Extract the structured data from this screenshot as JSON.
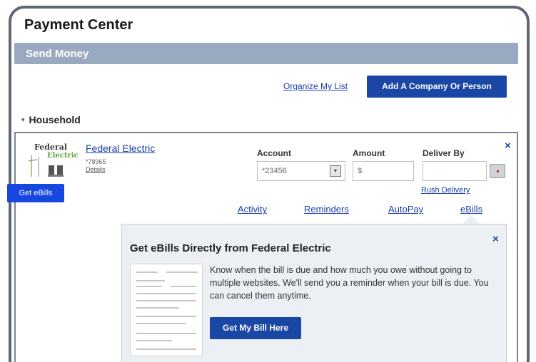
{
  "page": {
    "title": "Payment Center"
  },
  "section": {
    "title": "Send Money"
  },
  "toolbar": {
    "organize_label": "Organize My List",
    "add_label": "Add A Company Or Person"
  },
  "group": {
    "name": "Household"
  },
  "payee": {
    "logo_line1": "Federal",
    "logo_line2": "Electric",
    "name": "Federal Electric",
    "account_masked": "*78965",
    "details_label": "Details",
    "get_ebills_label": "Get eBills",
    "columns": {
      "account": "Account",
      "amount": "Amount",
      "deliver_by": "Deliver By"
    },
    "account_value": "*23456",
    "amount_placeholder": "$",
    "rush_delivery_label": "Rush Delivery",
    "tabs": [
      {
        "label": "Activity"
      },
      {
        "label": "Reminders"
      },
      {
        "label": "AutoPay"
      },
      {
        "label": "eBills"
      }
    ]
  },
  "ebills_panel": {
    "title": "Get eBills Directly from Federal Electric",
    "body": "Know when the bill is due and how much you owe without going to multiple websites. We'll send you a reminder when your bill is due. You can cancel them anytime.",
    "button_label": "Get My Bill Here"
  },
  "icons": {
    "close": "×",
    "dropdown": "▾",
    "caret": "▾"
  },
  "colors": {
    "accent": "#1a46a6",
    "link": "#1a3fa8",
    "section_bar": "#99a9c0",
    "ebills_tag": "#1747e0",
    "frame": "#5f6872"
  }
}
